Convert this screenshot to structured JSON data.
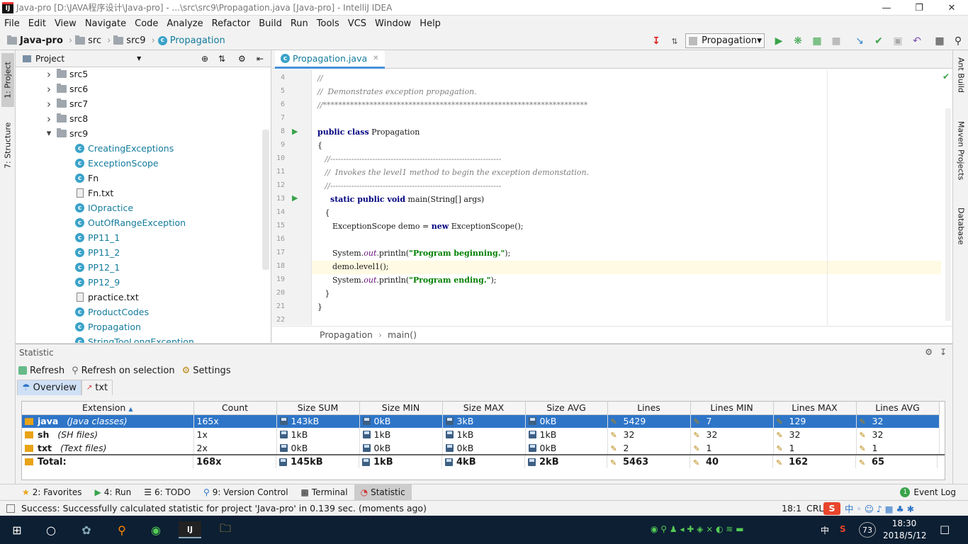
{
  "window": {
    "title": "Java-pro [D:\\JAVA程序设计\\Java-pro] - ...\\src\\src9\\Propagation.java [Java-pro] - IntelliJ IDEA",
    "app_badge": "IJ"
  },
  "menu": [
    "File",
    "Edit",
    "View",
    "Navigate",
    "Code",
    "Analyze",
    "Refactor",
    "Build",
    "Run",
    "Tools",
    "VCS",
    "Window",
    "Help"
  ],
  "breadcrumb": {
    "project": "Java-pro",
    "src": "src",
    "src9": "src9",
    "file": "Propagation"
  },
  "run_config": "Propagation",
  "left_tabs": {
    "project": "1: Project",
    "structure": "7: Structure"
  },
  "right_tabs": {
    "ant": "Ant Build",
    "maven": "Maven Projects",
    "database": "Database"
  },
  "project_panel": {
    "title": "Project",
    "tree": [
      {
        "label": "src5",
        "type": "folder",
        "expanded": false
      },
      {
        "label": "src6",
        "type": "folder",
        "expanded": false
      },
      {
        "label": "src7",
        "type": "folder",
        "expanded": false
      },
      {
        "label": "src8",
        "type": "folder",
        "expanded": false
      },
      {
        "label": "src9",
        "type": "folder",
        "expanded": true
      },
      {
        "label": "CreatingExceptions",
        "type": "class"
      },
      {
        "label": "ExceptionScope",
        "type": "class"
      },
      {
        "label": "Fn",
        "type": "class-plain"
      },
      {
        "label": "Fn.txt",
        "type": "text"
      },
      {
        "label": "IOpractice",
        "type": "class"
      },
      {
        "label": "OutOfRangeException",
        "type": "class"
      },
      {
        "label": "PP11_1",
        "type": "class"
      },
      {
        "label": "PP11_2",
        "type": "class"
      },
      {
        "label": "PP12_1",
        "type": "class"
      },
      {
        "label": "PP12_9",
        "type": "class"
      },
      {
        "label": "practice.txt",
        "type": "text"
      },
      {
        "label": "ProductCodes",
        "type": "class"
      },
      {
        "label": "Propagation",
        "type": "class"
      },
      {
        "label": "StringTooLongException",
        "type": "class"
      }
    ]
  },
  "editor": {
    "tab": "Propagation.java",
    "line_numbers": [
      "4",
      "5",
      "6",
      "7",
      "8",
      "9",
      "10",
      "11",
      "12",
      "13",
      "14",
      "15",
      "16",
      "17",
      "18",
      "19",
      "20",
      "21",
      "22"
    ],
    "lines": {
      "l4": "//",
      "l5": "//  Demonstrates exception propagation.",
      "l6": "//********************************************************************",
      "l8a": "public class",
      "l8b": " Propagation",
      "l9": "{",
      "l10": "   //-----------------------------------------------------------------",
      "l11": "   //  Invokes the level1 method to begin the exception demonstation.",
      "l12": "   //-----------------------------------------------------------------",
      "l13a": "static public void",
      "l13b": " main(String[] args)",
      "l14": "   {",
      "l15a": "      ExceptionScope demo = ",
      "l15b": "new",
      "l15c": " ExceptionScope();",
      "l17a": "      System.",
      "l17b": "out",
      "l17c": ".println(",
      "l17d": "\"Program beginning.\"",
      "l17e": ");",
      "l18": "      demo.level1();",
      "l19a": "      System.",
      "l19b": "out",
      "l19c": ".println(",
      "l19d": "\"Program ending.\"",
      "l19e": ");",
      "l20": "   }",
      "l21": "}"
    },
    "crumb_class": "Propagation",
    "crumb_method": "main()"
  },
  "statistic": {
    "title": "Statistic",
    "refresh": "Refresh",
    "refresh_selection": "Refresh on selection",
    "settings": "Settings",
    "tab_overview": "Overview",
    "tab_txt": "txt",
    "columns": [
      "Extension",
      "Count",
      "Size SUM",
      "Size MIN",
      "Size MAX",
      "Size AVG",
      "Lines",
      "Lines MIN",
      "Lines MAX",
      "Lines AVG"
    ],
    "rows": [
      {
        "ext": "java",
        "desc": "(Java classes)",
        "count": "165x",
        "sum": "143kB",
        "min": "0kB",
        "max": "3kB",
        "avg": "0kB",
        "lines": "5429",
        "lmin": "7",
        "lmax": "129",
        "lavg": "32"
      },
      {
        "ext": "sh",
        "desc": "(SH files)",
        "count": "1x",
        "sum": "1kB",
        "min": "1kB",
        "max": "1kB",
        "avg": "1kB",
        "lines": "32",
        "lmin": "32",
        "lmax": "32",
        "lavg": "32"
      },
      {
        "ext": "txt",
        "desc": "(Text files)",
        "count": "2x",
        "sum": "0kB",
        "min": "0kB",
        "max": "0kB",
        "avg": "0kB",
        "lines": "2",
        "lmin": "1",
        "lmax": "1",
        "lavg": "1"
      }
    ],
    "total": {
      "label": "Total:",
      "count": "168x",
      "sum": "145kB",
      "min": "1kB",
      "max": "4kB",
      "avg": "2kB",
      "lines": "5463",
      "lmin": "40",
      "lmax": "162",
      "lavg": "65"
    }
  },
  "bottom_tabs": {
    "favorites": "2: Favorites",
    "run": "4: Run",
    "todo": "6: TODO",
    "vcs": "9: Version Control",
    "terminal": "Terminal",
    "statistic": "Statistic",
    "eventlog": "Event Log",
    "eventlog_count": "1"
  },
  "status": {
    "message": "Success: Successfully calculated statistic for project 'Java-pro' in 0.139 sec. (moments ago)",
    "position": "18:1",
    "line_sep": "CRL"
  },
  "taskbar": {
    "time": "18:30",
    "date": "2018/5/12",
    "ime": "中",
    "temp": "73"
  },
  "colors": {
    "accent": "#2e75c8",
    "class_icon": "#3aa2c9",
    "run_green": "#3aa34a"
  }
}
